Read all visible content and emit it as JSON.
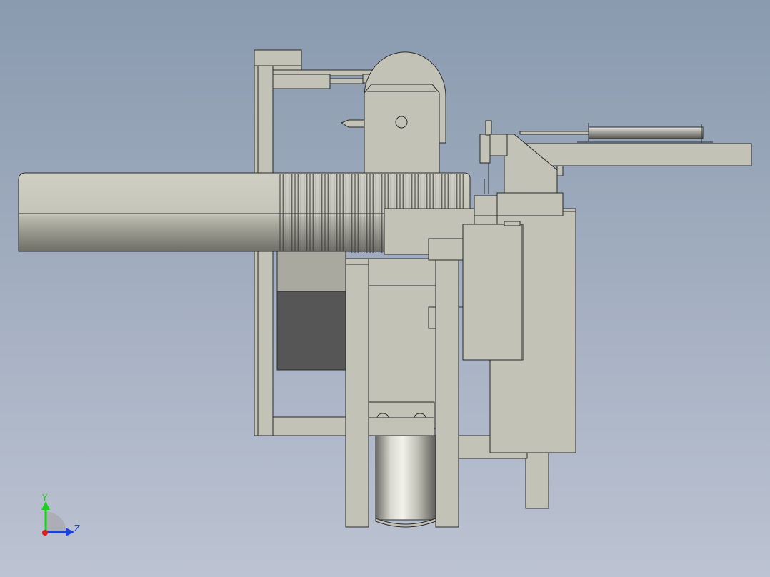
{
  "viewport": {
    "background_top": "#8a9aaf",
    "background_bottom": "#bcc3d2"
  },
  "colors": {
    "part_fill": "#c2c2b7",
    "part_stroke": "#2b2b2b",
    "dark_block": "#565656",
    "mid_block": "#a9a9a0",
    "motor_light": "#f2f2ea",
    "motor_dark": "#6b6b66"
  },
  "triad": {
    "y_label": "Y",
    "z_label": "Z",
    "y_color": "#1bd11b",
    "z_color": "#1b3fe0",
    "x_color": "#e01b1b"
  }
}
